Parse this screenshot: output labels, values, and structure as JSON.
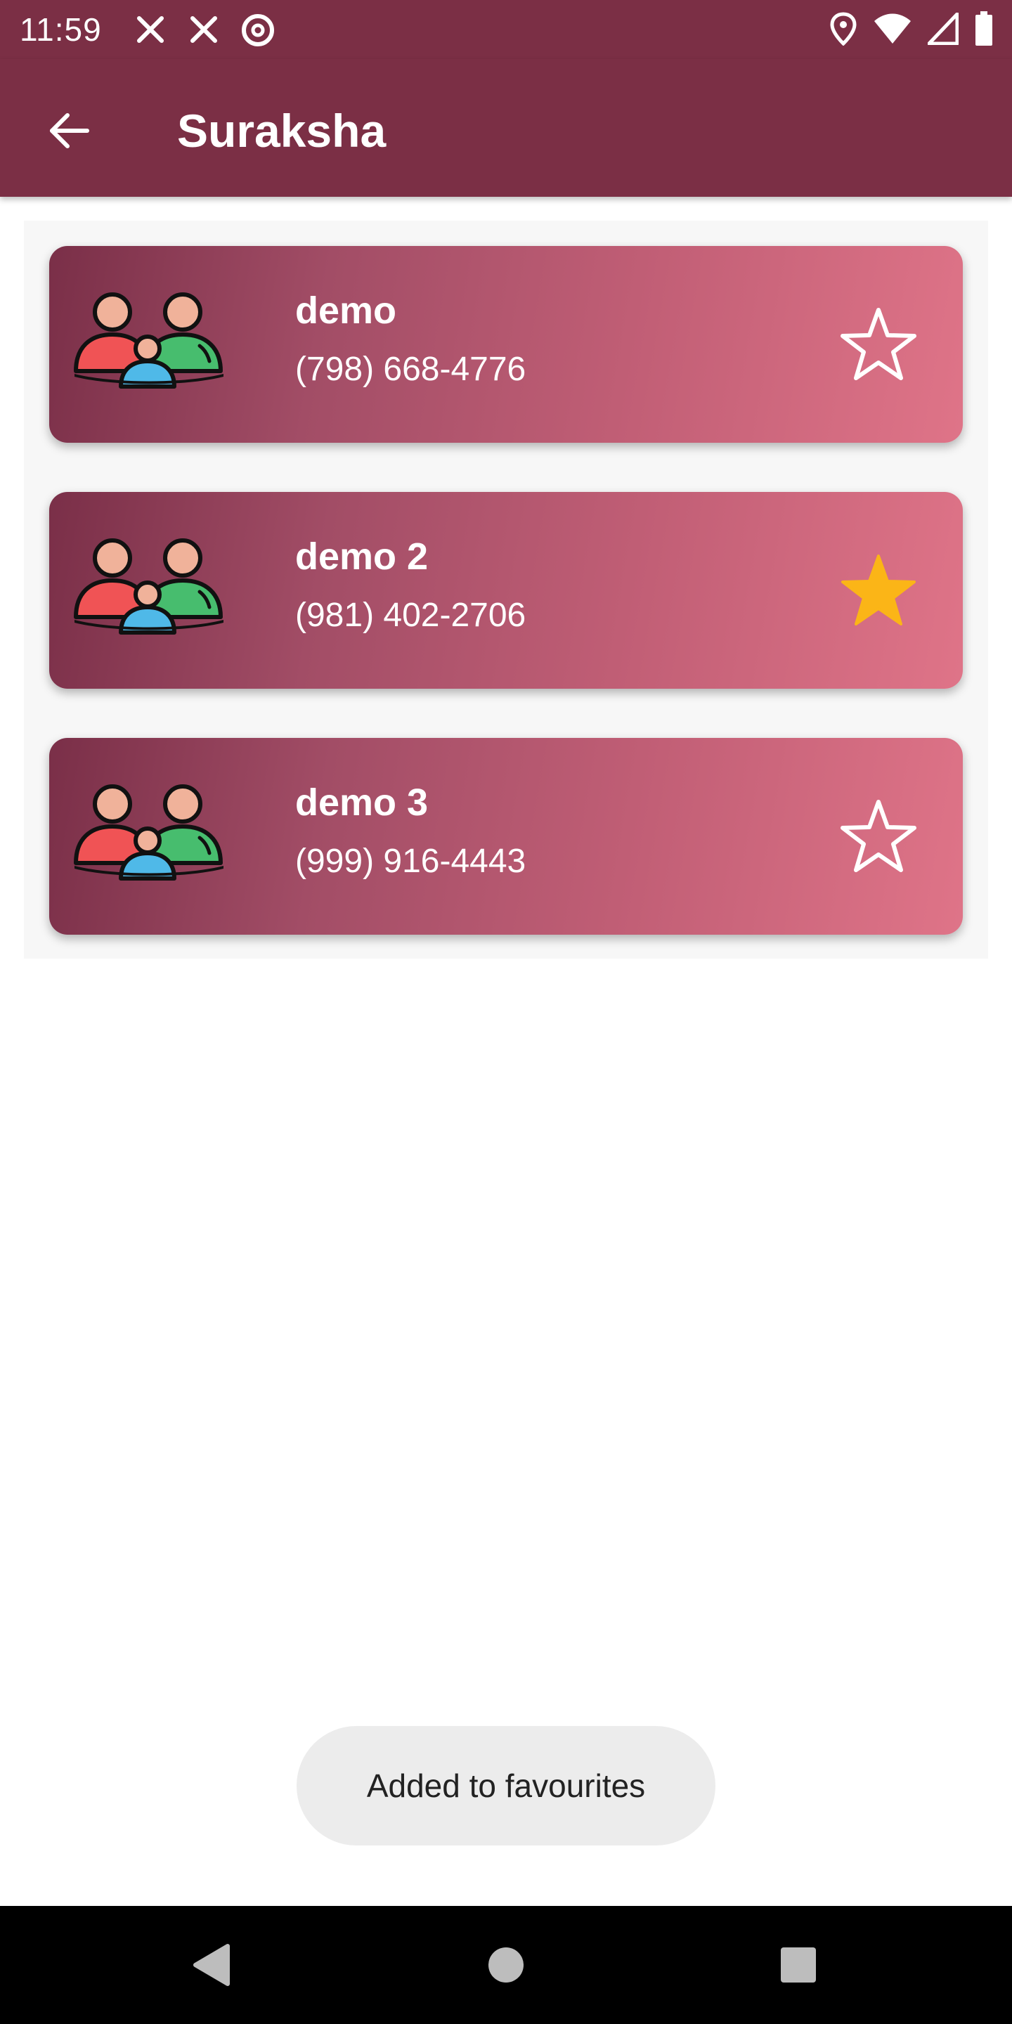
{
  "status_bar": {
    "time": "11:59",
    "left_icons": [
      "fork-knife-icon",
      "fork-knife-icon",
      "at-sign-icon"
    ],
    "right_icons": [
      "location-pin-icon",
      "wifi-icon",
      "signal-icon",
      "battery-icon"
    ]
  },
  "app_bar": {
    "title": "Suraksha",
    "back_icon": "arrow-left-icon"
  },
  "contacts": [
    {
      "name": "demo",
      "phone": "(798) 668-4776",
      "favourite": false
    },
    {
      "name": "demo 2",
      "phone": "(981) 402-2706",
      "favourite": true
    },
    {
      "name": "demo 3",
      "phone": "(999) 916-4443",
      "favourite": false
    }
  ],
  "toast": {
    "message": "Added to favourites"
  },
  "nav_bar": {
    "buttons": [
      "back-triangle-icon",
      "home-circle-icon",
      "recents-square-icon"
    ]
  },
  "colors": {
    "primary": "#7b2f45",
    "card_gradient_start": "#7a2f48",
    "card_gradient_end": "#df7488",
    "favourite_star": "#fbb517"
  }
}
